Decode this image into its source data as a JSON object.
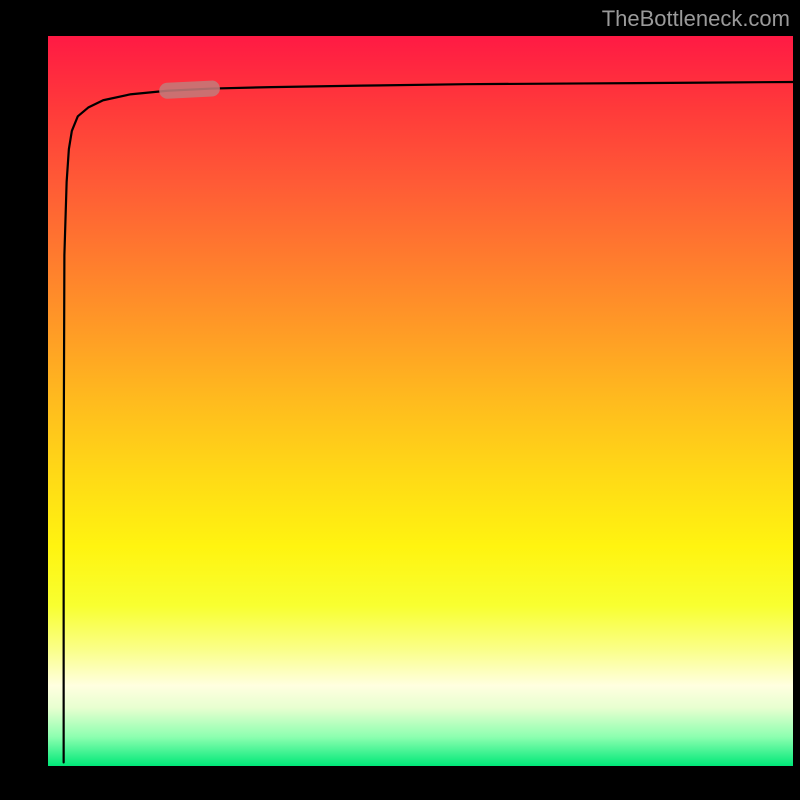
{
  "attribution": "TheBottleneck.com",
  "colors": {
    "background": "#000000",
    "gradient_top": "#ff1a44",
    "gradient_bottom": "#00e878",
    "curve": "#000000",
    "marker": "#c47979",
    "attribution_text": "#9a9a9a"
  },
  "chart_data": {
    "type": "line",
    "title": "",
    "xlabel": "",
    "ylabel": "",
    "xlim": [
      0,
      100
    ],
    "ylim": [
      0,
      100
    ],
    "description": "Logarithmic-shaped curve starting at bottom-left, rapidly rising along the left edge and flattening near the top as it crosses the width. A short pink marker highlights a segment of the curve in the upper-left region.",
    "series": [
      {
        "name": "curve",
        "x": [
          2.1,
          2.1,
          2.2,
          2.5,
          2.8,
          3.2,
          4.0,
          5.4,
          7.4,
          11.0,
          16.0,
          22.0,
          30.0,
          42.0,
          56.0,
          72.0,
          86.0,
          100.0
        ],
        "y": [
          0.5,
          40.0,
          70.0,
          80.0,
          84.5,
          87.0,
          89.0,
          90.2,
          91.2,
          92.0,
          92.5,
          92.8,
          93.0,
          93.2,
          93.4,
          93.5,
          93.6,
          93.7
        ]
      }
    ],
    "marker_segment": {
      "x": [
        16.0,
        22.0
      ],
      "y": [
        92.5,
        92.8
      ]
    },
    "gradient_stops": [
      {
        "pos": 0.0,
        "color": "#ff1a44"
      },
      {
        "pos": 0.1,
        "color": "#ff3a3a"
      },
      {
        "pos": 0.2,
        "color": "#ff5a36"
      },
      {
        "pos": 0.3,
        "color": "#ff7a2e"
      },
      {
        "pos": 0.4,
        "color": "#ff9a26"
      },
      {
        "pos": 0.5,
        "color": "#ffbb1e"
      },
      {
        "pos": 0.6,
        "color": "#ffd916"
      },
      {
        "pos": 0.7,
        "color": "#fff410"
      },
      {
        "pos": 0.78,
        "color": "#f8ff30"
      },
      {
        "pos": 0.84,
        "color": "#faff88"
      },
      {
        "pos": 0.89,
        "color": "#ffffe0"
      },
      {
        "pos": 0.92,
        "color": "#e8ffd0"
      },
      {
        "pos": 0.96,
        "color": "#8dffb0"
      },
      {
        "pos": 1.0,
        "color": "#00e878"
      }
    ]
  }
}
